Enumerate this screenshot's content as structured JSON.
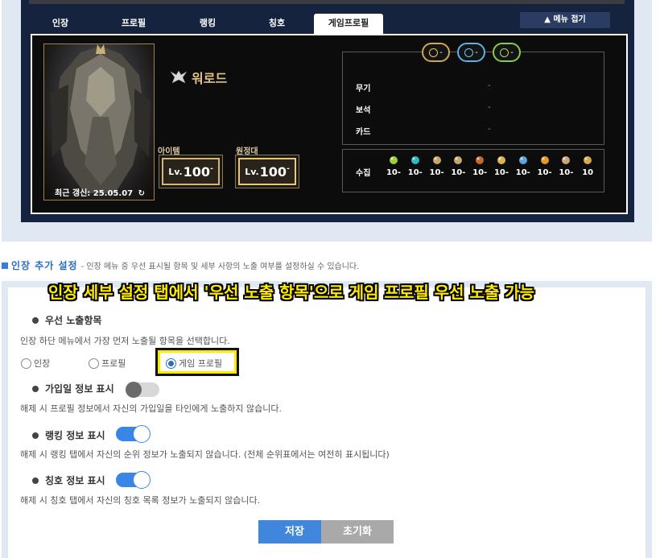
{
  "tabs": [
    {
      "label": "인장"
    },
    {
      "label": "프로필"
    },
    {
      "label": "랭킹"
    },
    {
      "label": "칭호"
    },
    {
      "label": "게임프로필"
    }
  ],
  "collapse_button": "▲ 메뉴 접기",
  "profile": {
    "class_name": "워로드",
    "last_update": "최근 갱신: 25.05.07",
    "item_level_label": "아이템",
    "item_level_prefix": "Lv.",
    "item_level_value": "100",
    "expedition_label": "원정대",
    "expedition_prefix": "Lv.",
    "expedition_value": "100",
    "elixirs": [
      "-",
      "-",
      "-"
    ],
    "gear_rows": [
      {
        "label": "무기",
        "value": "-"
      },
      {
        "label": "보석",
        "value": "-"
      },
      {
        "label": "카드",
        "value": "-"
      }
    ],
    "collect_label": "수집",
    "collect_values": [
      "10-",
      "10-",
      "10-",
      "10-",
      "10-",
      "10-",
      "10-",
      "10-",
      "10-",
      "10"
    ],
    "collect_colors": [
      "#9dcf3b",
      "#33b5c4",
      "#c9a46a",
      "#c7a56e",
      "#c56a2a",
      "#d9b25a",
      "#5aa7e0",
      "#e39a2b",
      "#c7a77a",
      "#d9a64b"
    ]
  },
  "section": {
    "title": "인장 추가 설정",
    "desc": "- 인장 메뉴 중 우선 표시될 항목 및 세부 사항의 노출 여부를 설정하실 수 있습니다."
  },
  "banner": "인장 세부 설정 탭에서 '우선 노출 항목'으로 게임 프로필 우선 노출 가능",
  "priority": {
    "heading": "우선 노출항목",
    "desc": "인장 하단 메뉴에서 가장 먼저 노출될 항목을 선택합니다.",
    "options": [
      "인장",
      "프로필",
      "게임 프로필"
    ],
    "selected": "게임 프로필"
  },
  "join_date": {
    "heading": "가입일 정보 표시",
    "enabled": false,
    "desc": "해제 시 프로필 정보에서 자신의 가입일을 타인에게 노출하지 않습니다."
  },
  "ranking": {
    "heading": "랭킹 정보 표시",
    "enabled": true,
    "desc": "해제 시 랭킹 탭에서 자신의 순위 정보가 노출되지 않습니다. (전체 순위표에서는 여전히 표시됩니다)"
  },
  "title_info": {
    "heading": "칭호 정보 표시",
    "enabled": true,
    "desc": "해제 시 칭호 탭에서 자신의 칭호 목록 정보가 노출되지 않습니다."
  },
  "buttons": {
    "save": "저장",
    "reset": "초기화"
  },
  "colors": {
    "accent": "#3f86dc",
    "navy": "#16233f",
    "gold": "#d6b676",
    "highlight": "#ffeb00"
  }
}
